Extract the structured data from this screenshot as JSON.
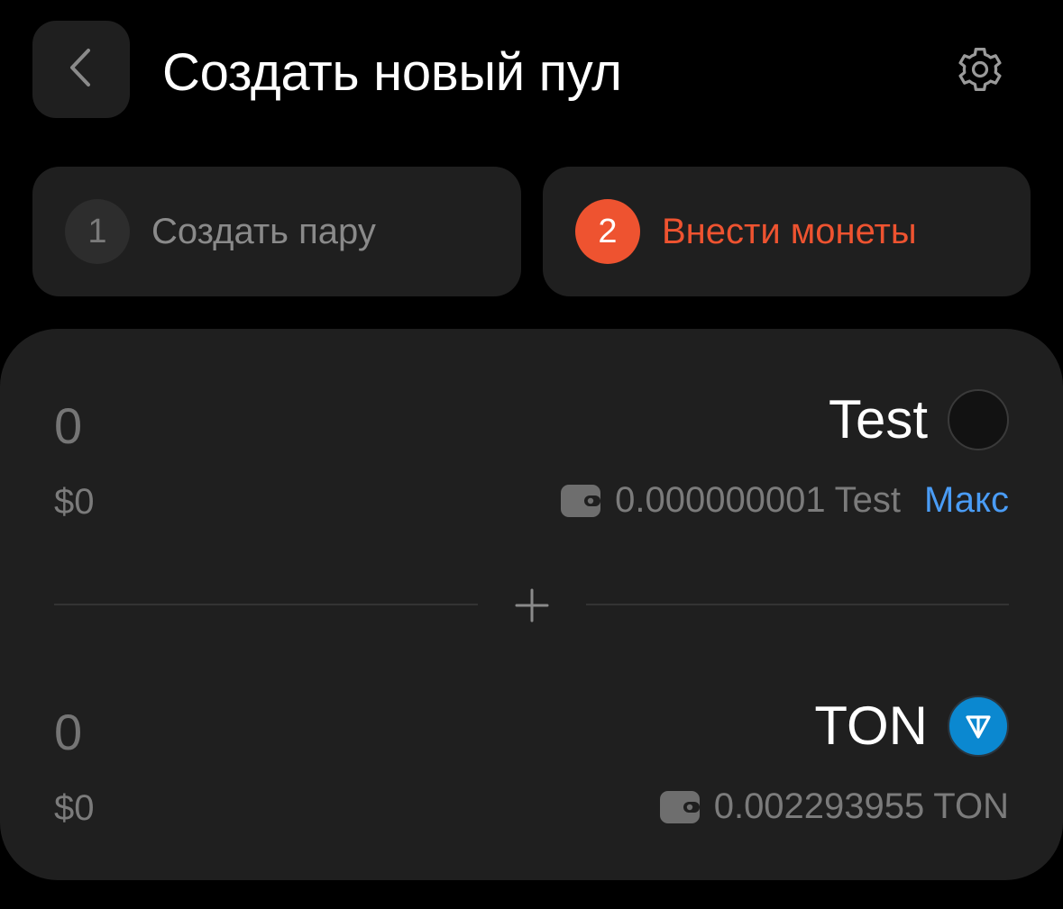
{
  "header": {
    "title": "Создать новый пул",
    "back_icon": "chevron-left-icon",
    "settings_icon": "gear-icon"
  },
  "steps": [
    {
      "number": "1",
      "label": "Создать пару",
      "active": false
    },
    {
      "number": "2",
      "label": "Внести монеты",
      "active": true
    }
  ],
  "tokens": [
    {
      "amount_placeholder": "0",
      "usd_value": "$0",
      "symbol": "Test",
      "balance_amount": "0.000000001",
      "balance_symbol": "Test",
      "max_label": "Макс"
    },
    {
      "amount_placeholder": "0",
      "usd_value": "$0",
      "symbol": "TON",
      "balance_amount": "0.002293955",
      "balance_symbol": "TON"
    }
  ],
  "colors": {
    "background": "#000000",
    "surface": "#1f1f1f",
    "accent": "#ee5330",
    "link": "#4a9cf5",
    "ton_blue": "#0b88d0"
  }
}
